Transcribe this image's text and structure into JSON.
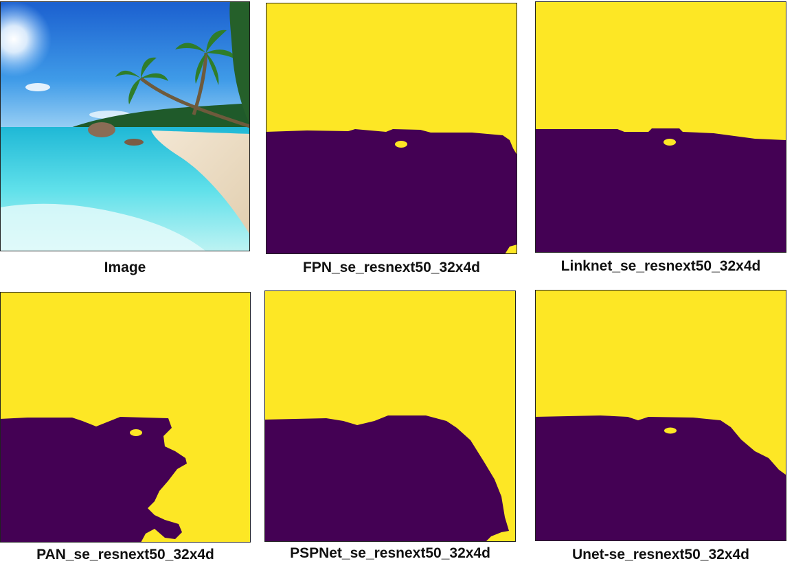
{
  "colors": {
    "background_class": "#fde725",
    "foreground_class": "#440154",
    "frame": "#222222"
  },
  "panels": [
    {
      "caption": "Image",
      "kind": "photo"
    },
    {
      "caption": "FPN_se_resnext50_32x4d",
      "kind": "mask"
    },
    {
      "caption": "Linknet_se_resnext50_32x4d",
      "kind": "mask"
    },
    {
      "caption": "PAN_se_resnext50_32x4d",
      "kind": "mask"
    },
    {
      "caption": "PSPNet_se_resnext50_32x4d",
      "kind": "mask"
    },
    {
      "caption": "Unet-se_resnext50_32x4d",
      "kind": "mask"
    }
  ]
}
